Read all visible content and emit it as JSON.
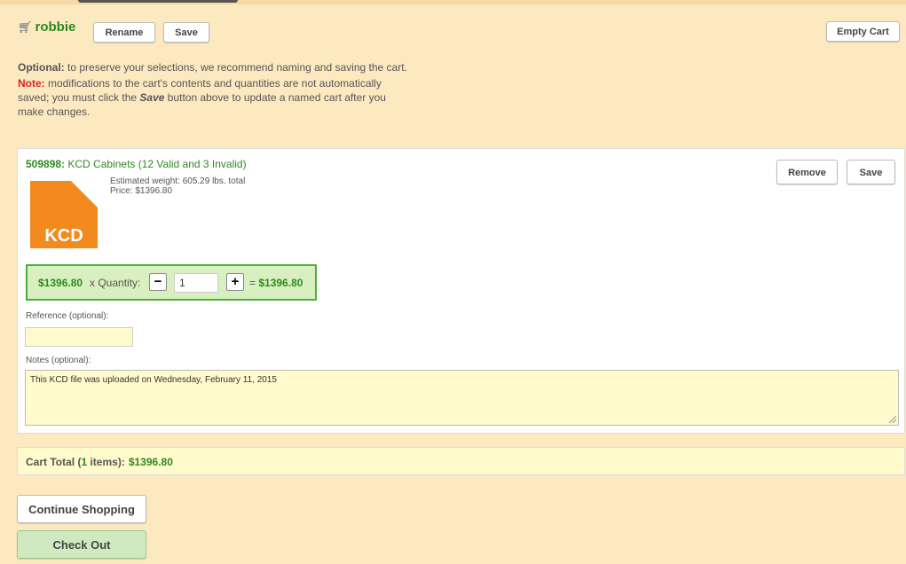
{
  "cart": {
    "name": "robbie",
    "rename_label": "Rename",
    "save_label": "Save",
    "empty_label": "Empty Cart"
  },
  "info": {
    "optional_label": "Optional:",
    "optional_text": " to preserve your selections, we recommend naming and saving the cart.",
    "note_label": "Note:",
    "note_text_1": " modifications to the cart's contents and quantities are not automatically saved; you must click the ",
    "note_save_word": "Save",
    "note_text_2": " button above to update a named cart after you make changes."
  },
  "item": {
    "id": "509898:",
    "title": " KCD Cabinets (12 Valid and 3 Invalid)",
    "logo_text": "KCD",
    "weight": "Estimated weight: 605.29 lbs. total",
    "price_line": "Price: $1396.80",
    "remove_label": "Remove",
    "save_label": "Save",
    "unit_price": "$1396.80",
    "qty_label": "x Quantity:",
    "minus": "−",
    "plus": "+",
    "quantity": "1",
    "equals": "=",
    "line_total": "$1396.80",
    "reference_label": "Reference (optional):",
    "notes_label": "Notes (optional):",
    "notes_value": "This KCD file was uploaded on Wednesday, February 11, 2015"
  },
  "total": {
    "label_prefix": "Cart Total (",
    "count": "1",
    "label_suffix": " items):",
    "value": "$1396.80"
  },
  "actions": {
    "continue_label": "Continue Shopping",
    "checkout_label": "Check Out"
  },
  "colors": {
    "background": "#fde9c0",
    "accent_green": "#2e8b1f",
    "note_red": "#e02020",
    "logo_orange": "#f28a1e"
  }
}
